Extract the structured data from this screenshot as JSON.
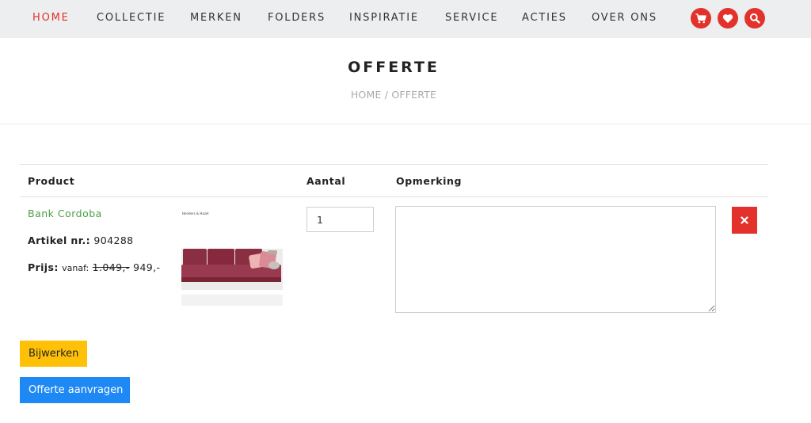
{
  "nav": {
    "items": [
      {
        "label": "HOME",
        "active": true
      },
      {
        "label": "COLLECTIE",
        "active": false
      },
      {
        "label": "MERKEN",
        "active": false
      },
      {
        "label": "FOLDERS",
        "active": false
      },
      {
        "label": "INSPIRATIE",
        "active": false
      },
      {
        "label": "SERVICE",
        "active": false
      },
      {
        "label": "ACTIES",
        "active": false
      },
      {
        "label": "OVER ONS",
        "active": false
      }
    ],
    "icons": [
      "cart-icon",
      "heart-icon",
      "search-icon"
    ]
  },
  "header": {
    "title": "OFFERTE",
    "breadcrumb": {
      "home": "HOME",
      "separator": " / ",
      "current": "OFFERTE"
    }
  },
  "table": {
    "headers": {
      "product": "Product",
      "quantity": "Aantal",
      "remark": "Opmerking"
    },
    "rows": [
      {
        "name": "Bank Cordoba",
        "article_label": "Artikel nr.:",
        "article_number": "904288",
        "price_label": "Prijs:",
        "price_prefix": "vanaf:",
        "old_price": "1.049,-",
        "price": "949,-",
        "image_caption": "Henders & Hazel",
        "quantity": "1",
        "remark": "",
        "remove_icon": "close-icon"
      }
    ]
  },
  "actions": {
    "update_label": "Bijwerken",
    "request_label": "Offerte aanvragen"
  },
  "colors": {
    "accent_red": "#e2322b",
    "link_green": "#4a9f46",
    "update_yellow": "#ffc107",
    "request_blue": "#1e88f5",
    "nav_bg": "#eceeef"
  }
}
